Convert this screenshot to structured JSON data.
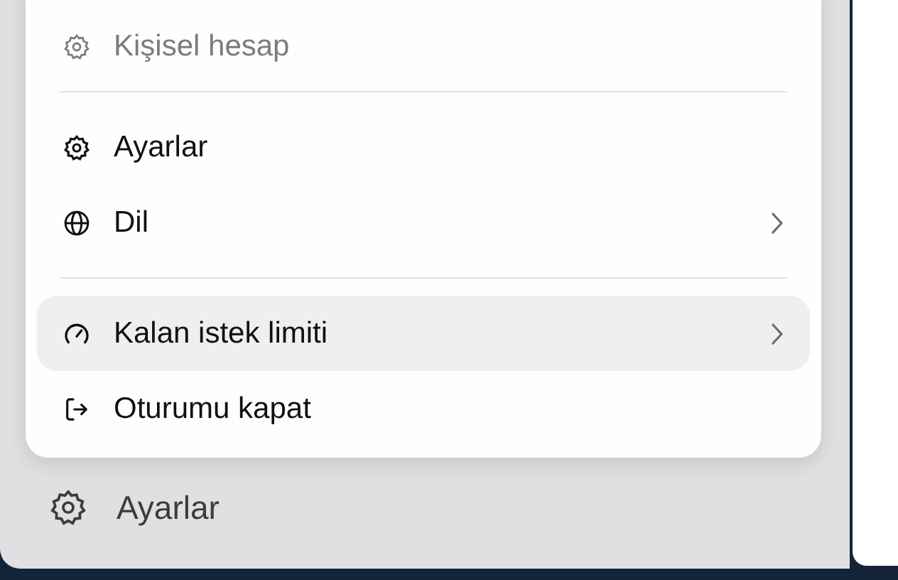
{
  "menu": {
    "items": [
      {
        "kind": "item",
        "label": "Kişisel hesap",
        "disabled": true,
        "selected": false,
        "submenu": false
      },
      {
        "kind": "divider"
      },
      {
        "kind": "item",
        "label": "Ayarlar",
        "disabled": false,
        "selected": false,
        "submenu": false
      },
      {
        "kind": "item",
        "label": "Dil",
        "disabled": false,
        "selected": false,
        "submenu": true
      },
      {
        "kind": "divider"
      },
      {
        "kind": "item",
        "label": "Kalan istek limiti",
        "disabled": false,
        "selected": true,
        "submenu": true
      },
      {
        "kind": "item",
        "label": "Oturumu kapat",
        "disabled": false,
        "selected": false,
        "submenu": false
      }
    ]
  },
  "sidebar": {
    "settings_label": "Ayarlar"
  }
}
